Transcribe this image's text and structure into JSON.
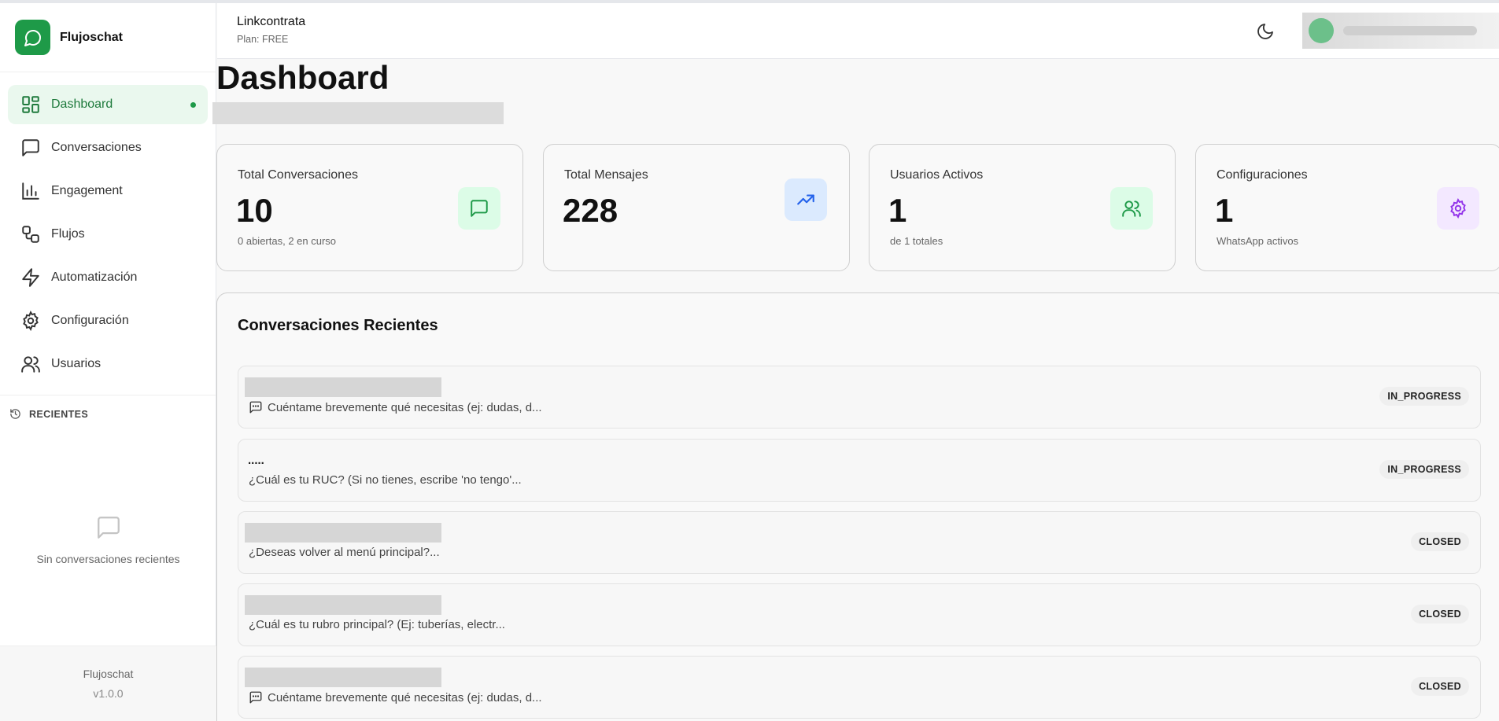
{
  "brand": {
    "name": "Flujoschat",
    "logo_icon": "chat-bubble-icon",
    "accent": "#1e9a48"
  },
  "sidebar": {
    "items": [
      {
        "label": "Dashboard",
        "icon": "dashboard-grid-icon",
        "active": true
      },
      {
        "label": "Conversaciones",
        "icon": "message-square-icon"
      },
      {
        "label": "Engagement",
        "icon": "bar-chart-icon"
      },
      {
        "label": "Flujos",
        "icon": "workflow-icon"
      },
      {
        "label": "Automatización",
        "icon": "lightning-icon"
      },
      {
        "label": "Configuración",
        "icon": "gear-icon"
      },
      {
        "label": "Usuarios",
        "icon": "users-icon"
      }
    ],
    "recent_heading": "RECIENTES",
    "recent_empty": "Sin conversaciones recientes",
    "footer": {
      "name": "Flujoschat",
      "version": "v1.0.0"
    }
  },
  "header": {
    "org_name": "Linkcontrata",
    "plan": "Plan: FREE",
    "theme_icon": "moon-icon"
  },
  "main": {
    "title": "Dashboard",
    "stats": [
      {
        "title": "Total Conversaciones",
        "value": "10",
        "sub": "0 abiertas, 2 en curso",
        "icon": "message-square-icon",
        "color": "#1e9a48"
      },
      {
        "title": "Total Mensajes",
        "value": "228",
        "sub": "",
        "icon": "trending-up-icon",
        "color": "#2563eb"
      },
      {
        "title": "Usuarios Activos",
        "value": "1",
        "sub": "de 1 totales",
        "icon": "users-icon",
        "color": "#1e9a48"
      },
      {
        "title": "Configuraciones",
        "value": "1",
        "sub": "WhatsApp activos",
        "icon": "gear-icon",
        "color": "#9333ea"
      }
    ],
    "recent_title": "Conversaciones Recientes",
    "conversations": [
      {
        "name": "",
        "message": "Cuéntame brevemente qué necesitas (ej: dudas, d...",
        "status": "IN_PROGRESS"
      },
      {
        "name": ".....",
        "message": "¿Cuál es tu RUC? (Si no tienes, escribe 'no tengo'...",
        "status": "IN_PROGRESS"
      },
      {
        "name": "",
        "message": "¿Deseas volver al menú principal?...",
        "status": "CLOSED"
      },
      {
        "name": "",
        "message": "¿Cuál es tu rubro principal? (Ej: tuberías, electr...",
        "status": "CLOSED"
      },
      {
        "name": "",
        "message": "Cuéntame brevemente qué necesitas (ej: dudas, d...",
        "status": "CLOSED"
      }
    ]
  }
}
